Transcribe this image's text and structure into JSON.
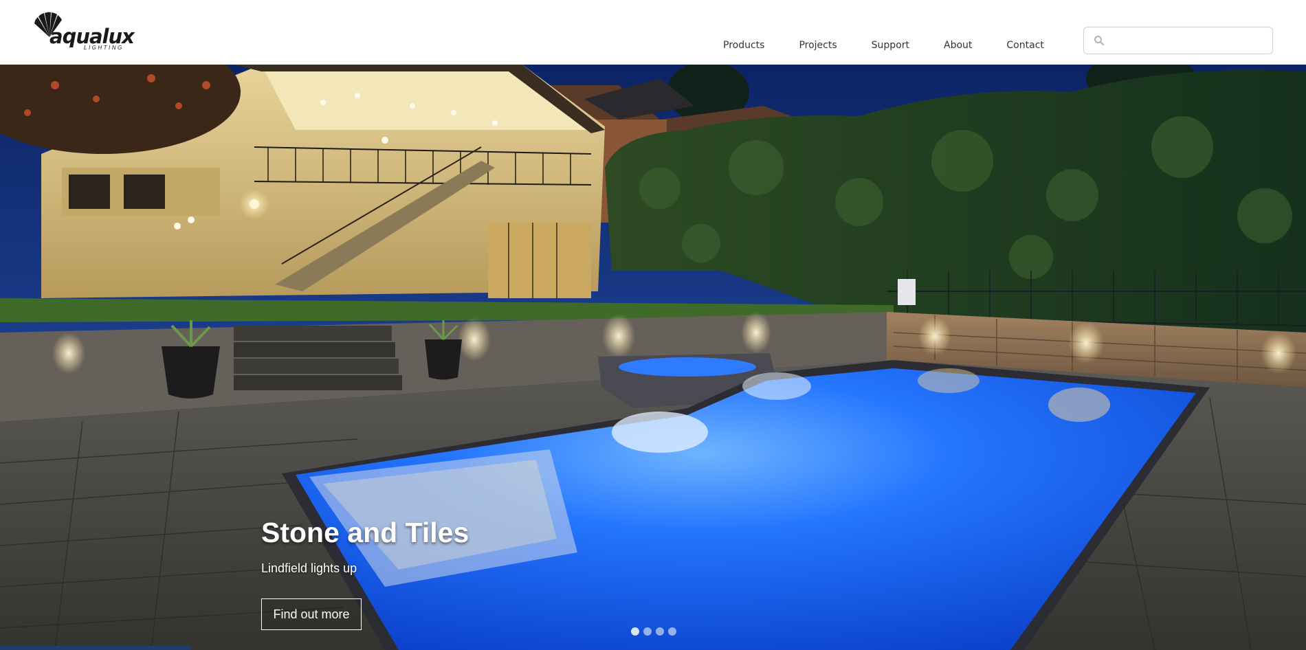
{
  "brand": {
    "name": "aqualux",
    "tagline": "LIGHTING"
  },
  "nav": {
    "items": [
      {
        "label": "Products"
      },
      {
        "label": "Projects"
      },
      {
        "label": "Support"
      },
      {
        "label": "About"
      },
      {
        "label": "Contact"
      }
    ]
  },
  "search": {
    "placeholder": "",
    "value": "",
    "icon": "search-icon"
  },
  "hero": {
    "title": "Stone and Tiles",
    "subtitle": "Lindfield lights up",
    "cta_label": "Find out more",
    "slides_total": 4,
    "active_slide": 1
  },
  "colors": {
    "accent_bar": "#1f3c6e",
    "pool_blue": "#1d6df5",
    "sky": "#0f2a6b"
  }
}
